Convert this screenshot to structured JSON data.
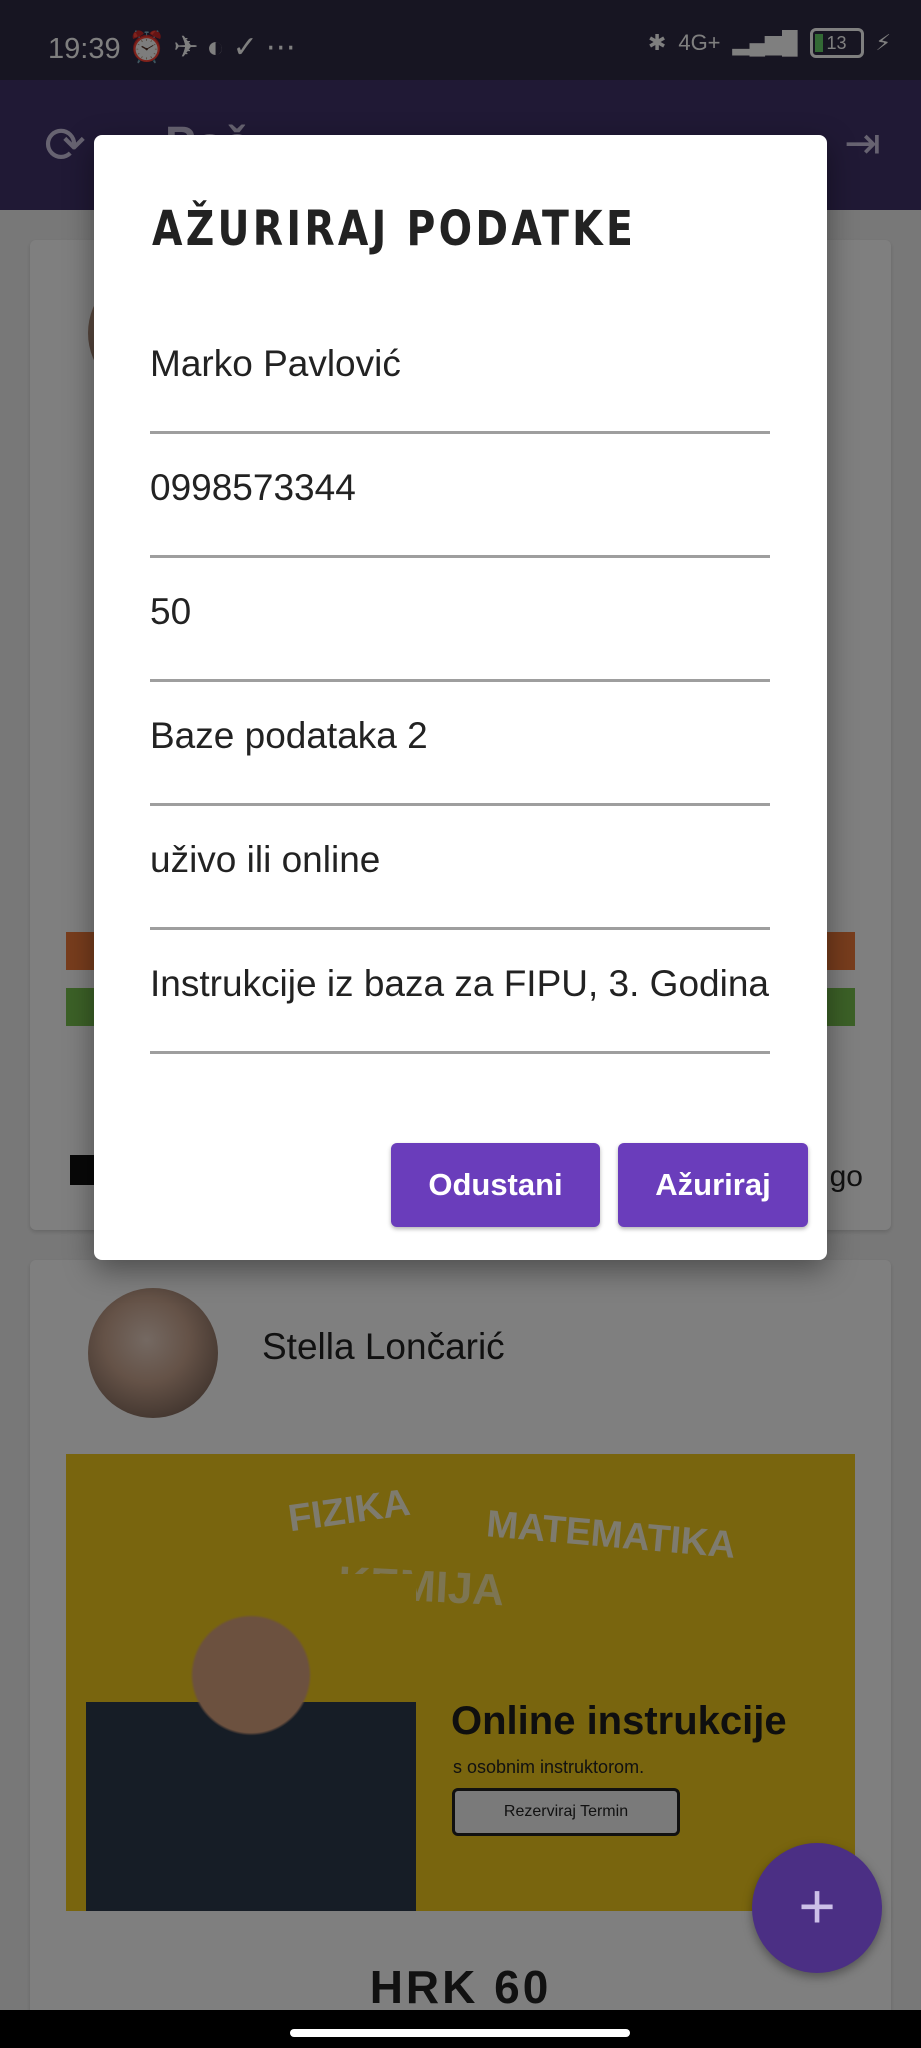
{
  "status_bar": {
    "time": "19:39",
    "network": "4G+",
    "battery": "13"
  },
  "app_bar": {
    "title_partial": "Poč",
    "refresh_icon": "refresh-icon",
    "logout_icon": "logout-icon"
  },
  "background": {
    "card1": {
      "trailing_text": "go"
    },
    "card2": {
      "name": "Stella Lončarić",
      "banner": {
        "words": [
          "FIZIKA",
          "MATEMATIKA",
          "KEMIJA"
        ],
        "headline": "Online instrukcije",
        "sub": "s osobnim instruktorom.",
        "cta": "Rezerviraj Termin"
      },
      "price": "HRK 60"
    },
    "fab_icon": "+"
  },
  "dialog": {
    "title": "AŽURIRAJ PODATKE",
    "fields": {
      "name": "Marko Pavlović",
      "phone": "0998573344",
      "price": "50",
      "subject": "Baze podataka 2",
      "mode": "uživo ili online",
      "description": "Instrukcije iz baza za FIPU, 3. Godina"
    },
    "buttons": {
      "cancel": "Odustani",
      "update": "Ažuriraj"
    }
  },
  "colors": {
    "accent": "#6a3dbb",
    "app_bar": "#40326a",
    "fab": "#4b2f84"
  }
}
